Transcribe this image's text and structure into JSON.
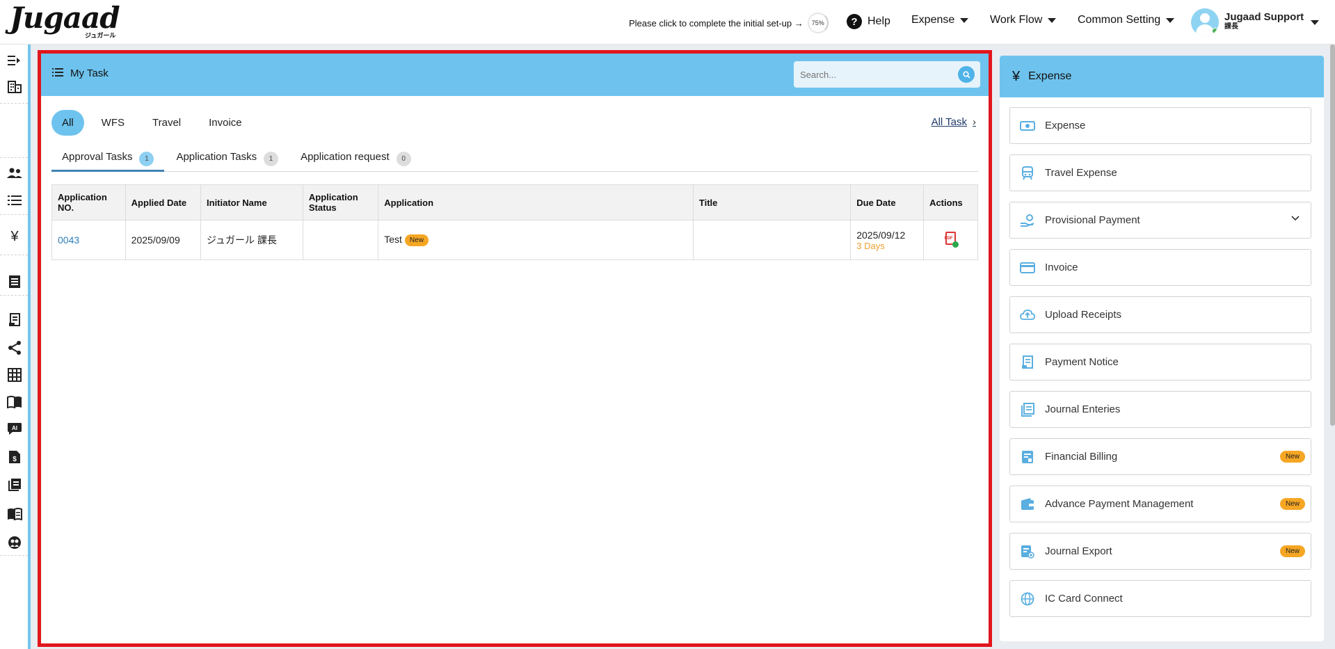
{
  "header": {
    "logo_text": "Jugaad",
    "logo_sub": "ジュガール",
    "setup_prompt": "Please click to complete the initial set-up →",
    "setup_progress": "75%",
    "help_label": "Help",
    "nav": [
      "Expense",
      "Work Flow",
      "Common Setting"
    ],
    "user_name": "Jugaad Support",
    "user_role": "課長"
  },
  "sidebar": {
    "icons": [
      "collapse-menu-icon",
      "building-icon",
      "users-icon",
      "list-icon",
      "yen-icon",
      "document-icon",
      "receipt-icon",
      "share-icon",
      "grid-icon",
      "book-icon",
      "ai-chat-icon",
      "invoice-dollar-icon",
      "journal-icon",
      "manual-icon",
      "support-icon"
    ]
  },
  "my_task": {
    "title": "My Task",
    "search_placeholder": "Search...",
    "filters": [
      "All",
      "WFS",
      "Travel",
      "Invoice"
    ],
    "active_filter": "All",
    "all_task_link": "All Task",
    "tabs": [
      {
        "label": "Approval Tasks",
        "count": "1"
      },
      {
        "label": "Application Tasks",
        "count": "1"
      },
      {
        "label": "Application request",
        "count": "0"
      }
    ],
    "columns": [
      "Application NO.",
      "Applied Date",
      "Initiator Name",
      "Application Status",
      "Application",
      "Title",
      "Due Date",
      "Actions"
    ],
    "rows": [
      {
        "app_no": "0043",
        "applied_date": "2025/09/09",
        "initiator": "ジュガール 課長",
        "status": "",
        "application": "Test",
        "application_badge": "New",
        "title": "",
        "due_date": "2025/09/12",
        "due_days": "3 Days",
        "pdf_label": "PDF"
      }
    ]
  },
  "expense_panel": {
    "title": "Expense",
    "items": [
      {
        "label": "Expense",
        "badge": ""
      },
      {
        "label": "Travel Expense",
        "badge": ""
      },
      {
        "label": "Provisional Payment",
        "badge": ""
      },
      {
        "label": "Invoice",
        "badge": ""
      },
      {
        "label": "Upload Receipts",
        "badge": ""
      },
      {
        "label": "Payment Notice",
        "badge": ""
      },
      {
        "label": "Journal Enteries",
        "badge": ""
      },
      {
        "label": "Financial Billing",
        "badge": "New"
      },
      {
        "label": "Advance Payment Management",
        "badge": "New"
      },
      {
        "label": "Journal Export",
        "badge": "New"
      },
      {
        "label": "IC Card Connect",
        "badge": ""
      }
    ]
  },
  "colors": {
    "accent": "#6ec3ee",
    "highlight_frame": "#e1161c",
    "badge_new": "#f5a623",
    "link": "#2d7db8"
  }
}
